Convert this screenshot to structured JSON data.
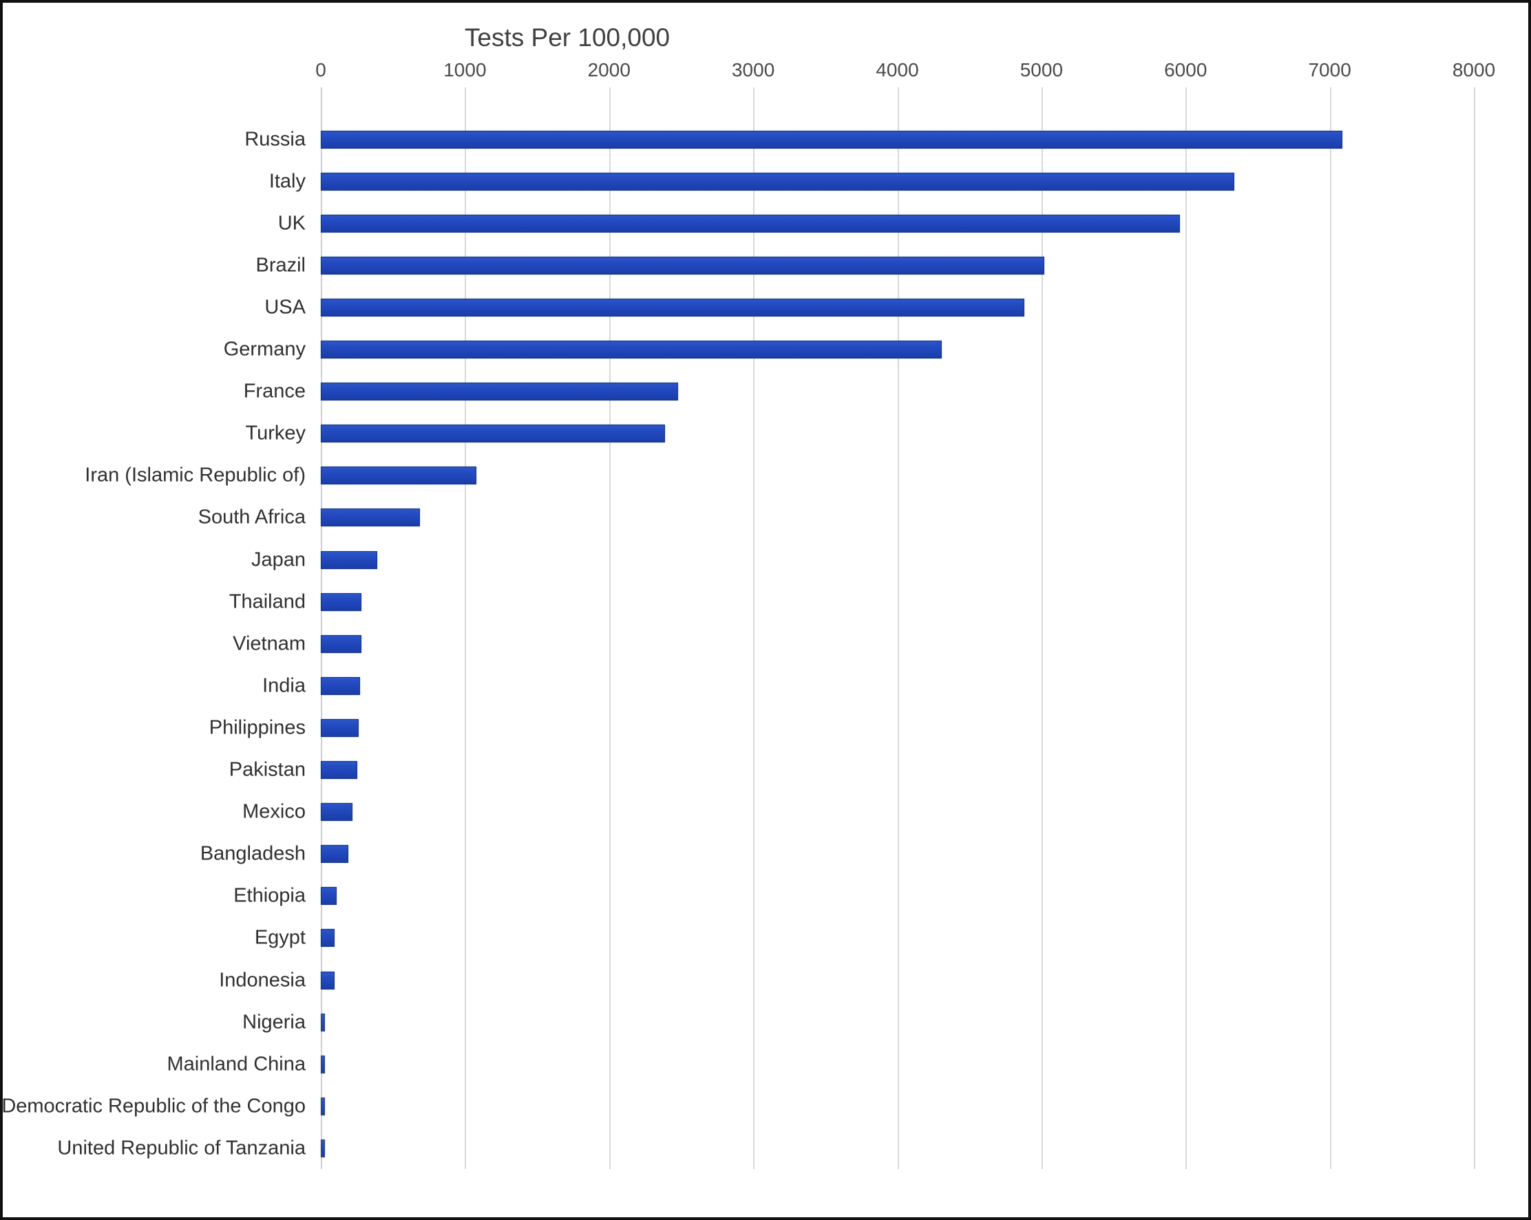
{
  "chart_data": {
    "type": "bar",
    "orientation": "horizontal",
    "title": "Tests Per 100,000",
    "xlabel": "",
    "ylabel": "",
    "xlim": [
      0,
      8000
    ],
    "xticks": [
      0,
      1000,
      2000,
      3000,
      4000,
      5000,
      6000,
      7000,
      8000
    ],
    "xtick_labels": [
      "0",
      "1000",
      "2000",
      "3000",
      "4000",
      "5000",
      "6000",
      "7000",
      "8000"
    ],
    "grid": true,
    "legend": false,
    "bar_color": "#2148bd",
    "bar_edge_color": "#16357f",
    "grid_color": "#d9d9d9",
    "categories": [
      "Russia",
      "Italy",
      "UK",
      "Brazil",
      "USA",
      "Germany",
      "France",
      "Turkey",
      "Iran (Islamic Republic of)",
      "South Africa",
      "Japan",
      "Thailand",
      "Vietnam",
      "India",
      "Philippines",
      "Pakistan",
      "Mexico",
      "Bangladesh",
      "Ethiopia",
      "Egypt",
      "Indonesia",
      "Nigeria",
      "Mainland China",
      "Democratic Republic of the Congo",
      "United Republic of Tanzania"
    ],
    "values": [
      7090,
      6340,
      5960,
      5020,
      4880,
      4310,
      2480,
      2390,
      1080,
      690,
      390,
      280,
      280,
      270,
      265,
      255,
      220,
      190,
      110,
      95,
      95,
      20,
      20,
      20,
      20
    ]
  }
}
